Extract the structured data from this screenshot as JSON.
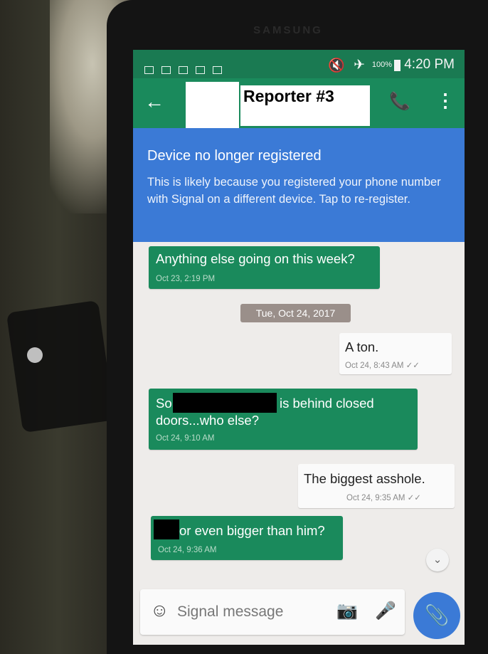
{
  "device": {
    "brand": "SAMSUNG"
  },
  "statusbar": {
    "battery": "100%",
    "time": "4:20 PM",
    "icons": [
      "notification-icon",
      "notification-icon",
      "notification-icon",
      "mail-icon",
      "image-icon",
      "mute-icon",
      "airplane-icon",
      "battery-icon"
    ]
  },
  "toolbar": {
    "title": "Reporter #3",
    "back_icon": "arrow-left-icon",
    "call_icon": "phone-icon",
    "menu_icon": "more-vert-icon"
  },
  "banner": {
    "title": "Device no longer registered",
    "body": "This is likely because you registered your phone number with Signal on a different device. Tap to re-register."
  },
  "messages": [
    {
      "direction": "incoming",
      "text": "Anything else going on this week?",
      "time": "Oct 23, 2:19 PM"
    },
    {
      "type": "date",
      "text": "Tue, Oct 24, 2017"
    },
    {
      "direction": "outgoing",
      "text": "A ton.",
      "time": "Oct 24, 8:43 AM"
    },
    {
      "direction": "incoming",
      "text_pre": "So",
      "text_post": "is behind closed",
      "text_line2": "doors...who else?",
      "time": "Oct 24, 9:10 AM"
    },
    {
      "direction": "outgoing",
      "text": "The biggest asshole.",
      "time": "Oct 24, 9:35 AM"
    },
    {
      "direction": "incoming",
      "text": "or even bigger than him?",
      "time": "Oct 24, 9:36 AM"
    }
  ],
  "composer": {
    "placeholder": "Signal message"
  },
  "colors": {
    "green": "#1a8a5c",
    "blue": "#3b7ad6",
    "status_green": "#1a7a52"
  }
}
